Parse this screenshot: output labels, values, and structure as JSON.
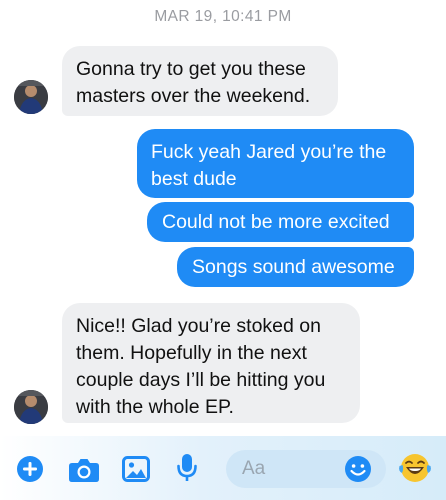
{
  "conversation": {
    "timestamp": "MAR 19, 10:41 PM",
    "messages": [
      {
        "direction": "incoming",
        "lines": [
          "Gonna try to get you these",
          "masters over the weekend."
        ]
      },
      {
        "direction": "outgoing",
        "lines": [
          "Fuck yeah Jared you’re the",
          "best dude"
        ]
      },
      {
        "direction": "outgoing",
        "lines": [
          "Could not be more excited"
        ]
      },
      {
        "direction": "outgoing",
        "lines": [
          "Songs sound awesome"
        ]
      },
      {
        "direction": "incoming",
        "lines": [
          "Nice!! Glad you’re stoked on",
          "them. Hopefully in the next",
          "couple days I’ll be hitting you",
          "with the whole EP."
        ]
      }
    ]
  },
  "composer": {
    "placeholder": "Aa",
    "icons": [
      "plus-icon",
      "camera-icon",
      "image-icon",
      "microphone-icon",
      "emoji-icon",
      "laughing-emoji-icon"
    ]
  },
  "colors": {
    "outgoing_bubble": "#1f8bf5",
    "incoming_bubble": "#eeeff1",
    "accent": "#1f8bf5",
    "timestamp": "#9a9ca1"
  }
}
